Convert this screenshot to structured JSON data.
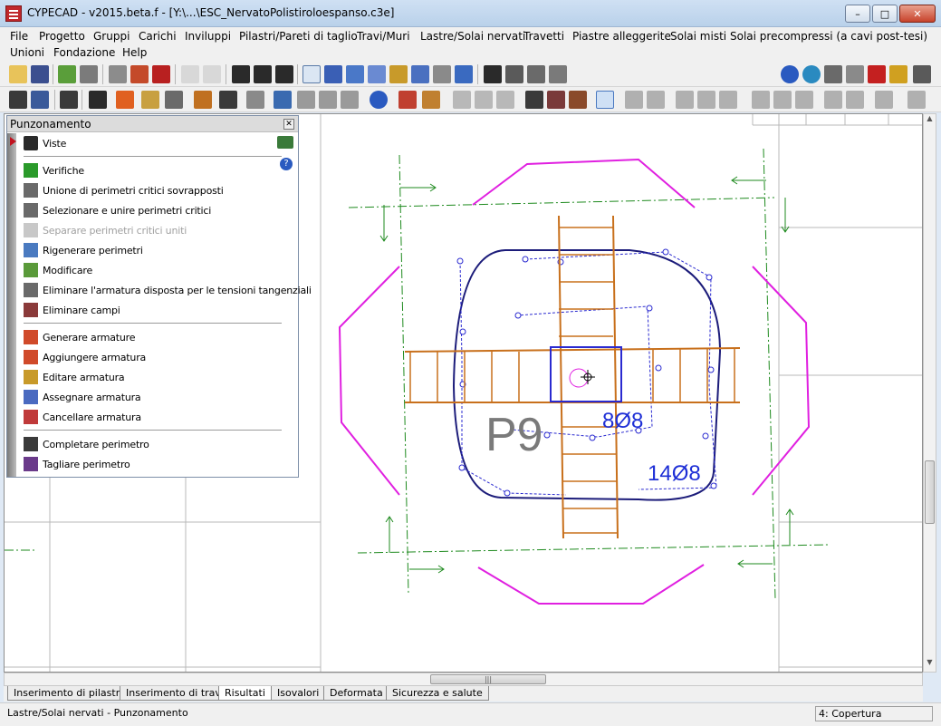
{
  "window": {
    "title": "CYPECAD - v2015.beta.f - [Y:\\...\\ESC_NervatoPolistiroloespanso.c3e]"
  },
  "menu": [
    "File",
    "Progetto",
    "Gruppi",
    "Carichi",
    "Inviluppi",
    "Pilastri/Pareti di taglio",
    "Travi/Muri",
    "Lastre/Solai nervati",
    "Travetti",
    "Piastre alleggerite",
    "Solai misti",
    "Solai precompressi (a cavi post-tesi)",
    "Unioni",
    "Fondazione",
    "Help"
  ],
  "panel": {
    "title": "Punzonamento",
    "items": [
      {
        "label": "Viste",
        "icon": "eye-icon",
        "disabled": false
      },
      {
        "label": "Verifiche",
        "icon": "check-icon",
        "disabled": false
      },
      {
        "label": "Unione di perimetri critici sovrapposti",
        "icon": "merge-perimeters-icon",
        "disabled": false
      },
      {
        "label": "Selezionare e unire perimetri critici",
        "icon": "select-merge-icon",
        "disabled": false
      },
      {
        "label": "Separare perimetri critici uniti",
        "icon": "separate-perimeters-icon",
        "disabled": true
      },
      {
        "label": "Rigenerare perimetri",
        "icon": "regenerate-icon",
        "disabled": false
      },
      {
        "label": "Modificare",
        "icon": "edit-icon",
        "disabled": false
      },
      {
        "label": "Eliminare l'armatura disposta per le tensioni tangenziali",
        "icon": "delete-shear-rebar-icon",
        "disabled": false
      },
      {
        "label": "Eliminare campi",
        "icon": "delete-fields-icon",
        "disabled": false
      },
      {
        "label": "Generare armature",
        "icon": "generate-rebar-icon",
        "disabled": false
      },
      {
        "label": "Aggiungere armatura",
        "icon": "add-rebar-icon",
        "disabled": false
      },
      {
        "label": "Editare armatura",
        "icon": "edit-rebar-icon",
        "disabled": false
      },
      {
        "label": "Assegnare armatura",
        "icon": "assign-rebar-icon",
        "disabled": false
      },
      {
        "label": "Cancellare armatura",
        "icon": "delete-rebar-icon",
        "disabled": false
      },
      {
        "label": "Completare perimetro",
        "icon": "complete-perimeter-icon",
        "disabled": false
      },
      {
        "label": "Tagliare perimetro",
        "icon": "cut-perimeter-icon",
        "disabled": false
      }
    ]
  },
  "drawing": {
    "column_label": "P9",
    "rebar_label_1": "8Ø8",
    "rebar_label_2": "14Ø8"
  },
  "tabs": [
    {
      "label": "Inserimento di pilastri",
      "active": false
    },
    {
      "label": "Inserimento di travi",
      "active": false
    },
    {
      "label": "Risultati",
      "active": true
    },
    {
      "label": "Isovalori",
      "active": false
    },
    {
      "label": "Deformata",
      "active": false
    },
    {
      "label": "Sicurezza e salute",
      "active": false
    }
  ],
  "status": {
    "left": "Lastre/Solai nervati - Punzonamento",
    "right": "4: Copertura"
  },
  "colors": {
    "accent_orange": "#c8701c",
    "navy": "#1c1c7a",
    "magenta": "#e020e0",
    "green_dashed": "#1e8a1e",
    "blue_text": "#1e2fd6"
  }
}
